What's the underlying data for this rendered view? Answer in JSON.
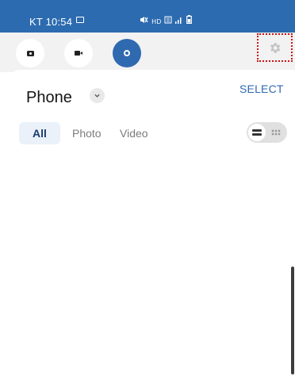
{
  "status_bar": {
    "time": "KT 10:54",
    "icons": [
      "gallery-icon",
      "mute-icon",
      "volte-icon",
      "signal-icon",
      "battery-icon"
    ],
    "hd_label": "HD",
    "color": "#2d6bb0"
  },
  "toolbar": {
    "modes": [
      {
        "name": "photo",
        "icon": "camera-icon",
        "active": false
      },
      {
        "name": "video",
        "icon": "video-camera-icon",
        "active": false
      },
      {
        "name": "screen-record",
        "icon": "record-icon",
        "active": true
      }
    ],
    "settings_icon": "gear-icon",
    "accent": "#2f6ab1"
  },
  "header": {
    "title": "Phone",
    "dropdown_icon": "chevron-down-icon",
    "select_label": "SELECT"
  },
  "filters": {
    "tabs": [
      {
        "label": "All",
        "active": true
      },
      {
        "label": "Photo",
        "active": false
      },
      {
        "label": "Video",
        "active": false
      }
    ]
  },
  "view_toggle": {
    "selected": "list",
    "options": [
      "list-view-icon",
      "grid-view-icon"
    ]
  }
}
